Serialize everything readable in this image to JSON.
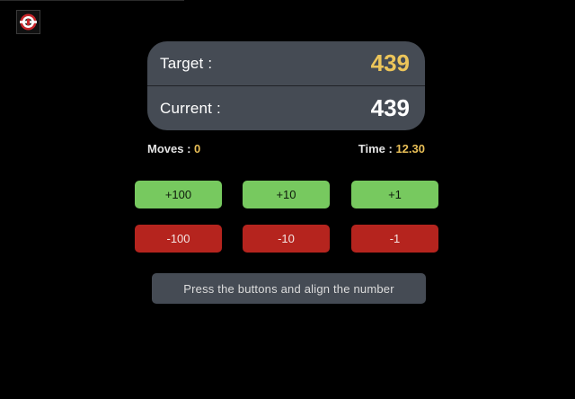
{
  "app": {
    "logo_icon": "game-logo-icon"
  },
  "display": {
    "target_label": "Target :",
    "target_value": "439",
    "current_label": "Current :",
    "current_value": "439"
  },
  "stats": {
    "moves_label": "Moves",
    "moves_value": "0",
    "time_label": "Time",
    "time_value": "12.30",
    "separator": ":"
  },
  "buttons": {
    "plus": [
      "+100",
      "+10",
      "+1"
    ],
    "minus": [
      "-100",
      "-10",
      "-1"
    ]
  },
  "hint": {
    "text": "Press the buttons and align the number"
  },
  "colors": {
    "background": "#000000",
    "panel": "#454b54",
    "accent_gold": "#ecc55a",
    "plus_button": "#77c95f",
    "minus_button": "#b5241e"
  }
}
